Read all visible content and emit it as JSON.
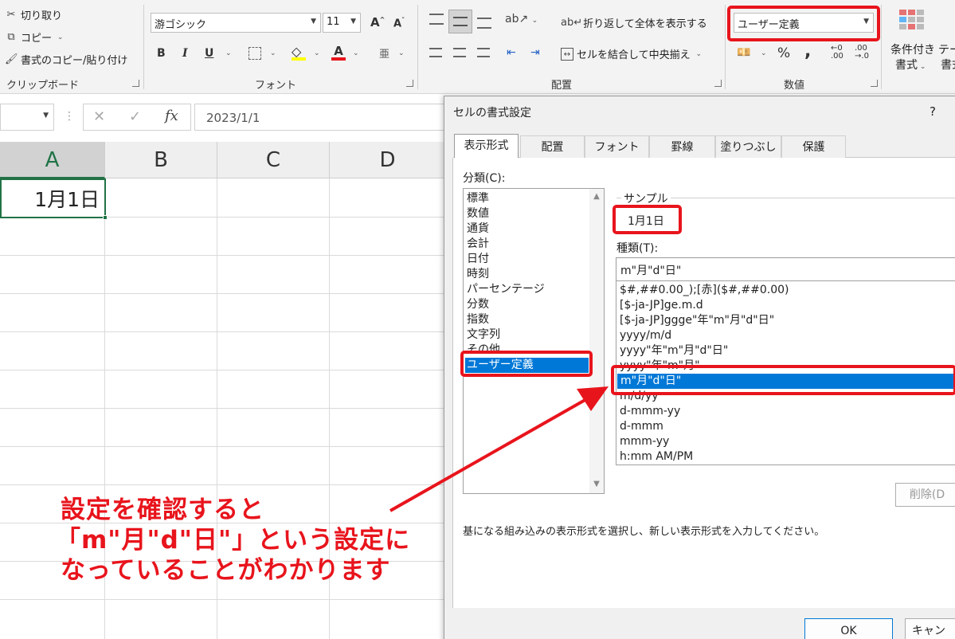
{
  "ribbon": {
    "clipboard": {
      "cut": "切り取り",
      "copy": "コピー",
      "format_painter": "書式のコピー/貼り付け",
      "label": "クリップボード"
    },
    "font": {
      "name": "游ゴシック",
      "size": "11",
      "label": "フォント",
      "bold": "B",
      "italic": "I",
      "underline": "U",
      "font_color": "A",
      "grow": "A",
      "shrink": "A"
    },
    "alignment": {
      "wrap_text": "折り返して全体を表示する",
      "merge_center": "セルを結合して中央揃え",
      "label": "配置"
    },
    "number": {
      "format": "ユーザー定義",
      "percent": "%",
      "comma": ",",
      "inc_decimal": ".00",
      "dec_decimal": ".0",
      "label": "数値"
    },
    "styles": {
      "conditional_line1": "条件付き",
      "conditional_line2": "書式",
      "table_line1": "テー",
      "table_line2": "書式"
    }
  },
  "formula_bar": {
    "fx": "fx",
    "value": "2023/1/1"
  },
  "sheet": {
    "columns": [
      "A",
      "B",
      "C",
      "D"
    ],
    "cell_a1": "1月1日"
  },
  "dialog": {
    "title": "セルの書式設定",
    "help": "?",
    "tabs": [
      "表示形式",
      "配置",
      "フォント",
      "罫線",
      "塗りつぶし",
      "保護"
    ],
    "category_label": "分類(C):",
    "categories": [
      "標準",
      "数値",
      "通貨",
      "会計",
      "日付",
      "時刻",
      "パーセンテージ",
      "分数",
      "指数",
      "文字列",
      "その他",
      "ユーザー定義"
    ],
    "sample_label": "サンプル",
    "sample_value": "1月1日",
    "type_label": "種類(T):",
    "type_value": "m\"月\"d\"日\"",
    "types": [
      "$#,##0.00_);[赤]($#,##0.00)",
      "[$-ja-JP]ge.m.d",
      "[$-ja-JP]ggge\"年\"m\"月\"d\"日\"",
      "yyyy/m/d",
      "yyyy\"年\"m\"月\"d\"日\"",
      "yyyy\"年\"m\"月\"",
      "m\"月\"d\"日\"",
      "m/d/yy",
      "d-mmm-yy",
      "d-mmm",
      "mmm-yy",
      "h:mm AM/PM"
    ],
    "delete_button": "削除(D",
    "description": "基になる組み込みの表示形式を選択し、新しい表示形式を入力してください。",
    "ok_button": "OK",
    "cancel_button": "キャン"
  },
  "annotation": {
    "line1": "設定を確認すると",
    "line2": "「m\"月\"d\"日\"」という設定に",
    "line3": "なっていることがわかります"
  },
  "colors": {
    "highlight": "#e8141c",
    "selection": "#0078d7",
    "active_cell": "#217346"
  }
}
